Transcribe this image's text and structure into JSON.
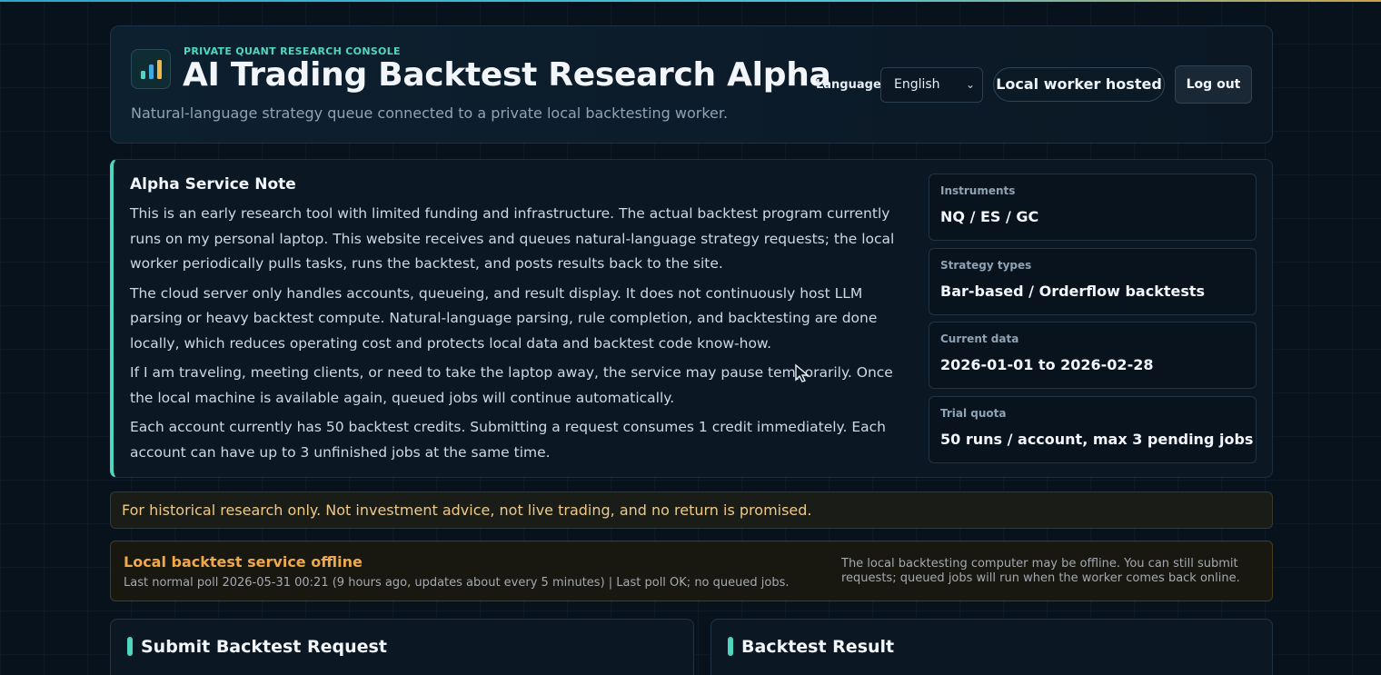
{
  "header": {
    "kicker": "PRIVATE QUANT RESEARCH CONSOLE",
    "title": "AI Trading Backtest Research Alpha",
    "subtitle": "Natural-language strategy queue connected to a private local backtesting worker.",
    "language_label": "Language",
    "language_selected": "English",
    "worker_status": "Local worker hosted",
    "logout_label": "Log out",
    "logo_icon": "bar-chart-icon"
  },
  "note": {
    "title": "Alpha Service Note",
    "paragraphs": [
      "This is an early research tool with limited funding and infrastructure. The actual backtest program currently runs on my personal laptop. This website receives and queues natural-language strategy requests; the local worker periodically pulls tasks, runs the backtest, and posts results back to the site.",
      "The cloud server only handles accounts, queueing, and result display. It does not continuously host LLM parsing or heavy backtest compute. Natural-language parsing, rule completion, and backtesting are done locally, which reduces operating cost and protects local data and backtest code know-how.",
      "If I am traveling, meeting clients, or need to take the laptop away, the service may pause temporarily. Once the local machine is available again, queued jobs will continue automatically.",
      "Each account currently has 50 backtest credits. Submitting a request consumes 1 credit immediately. Each account can have up to 3 unfinished jobs at the same time."
    ],
    "stats": [
      {
        "label": "Instruments",
        "value": "NQ / ES / GC"
      },
      {
        "label": "Strategy types",
        "value": "Bar-based / Orderflow backtests"
      },
      {
        "label": "Current data",
        "value": "2026-01-01 to 2026-02-28"
      },
      {
        "label": "Trial quota",
        "value": "50 runs / account, max 3 pending jobs"
      }
    ]
  },
  "disclaimer": "For historical research only. Not investment advice, not live trading, and no return is promised.",
  "offline": {
    "title": "Local backtest service offline",
    "status": "Last normal poll 2026-05-31 00:21 (9 hours ago, updates about every 5 minutes) | Last poll OK; no queued jobs.",
    "note": "The local backtesting computer may be offline. You can still submit requests; queued jobs will run when the worker comes back online."
  },
  "panels": {
    "submit_title": "Submit Backtest Request",
    "result_title": "Backtest Result"
  },
  "colors": {
    "accent": "#4fd6c1",
    "warning": "#f0a94a",
    "disclaimer_text": "#ecc987"
  }
}
